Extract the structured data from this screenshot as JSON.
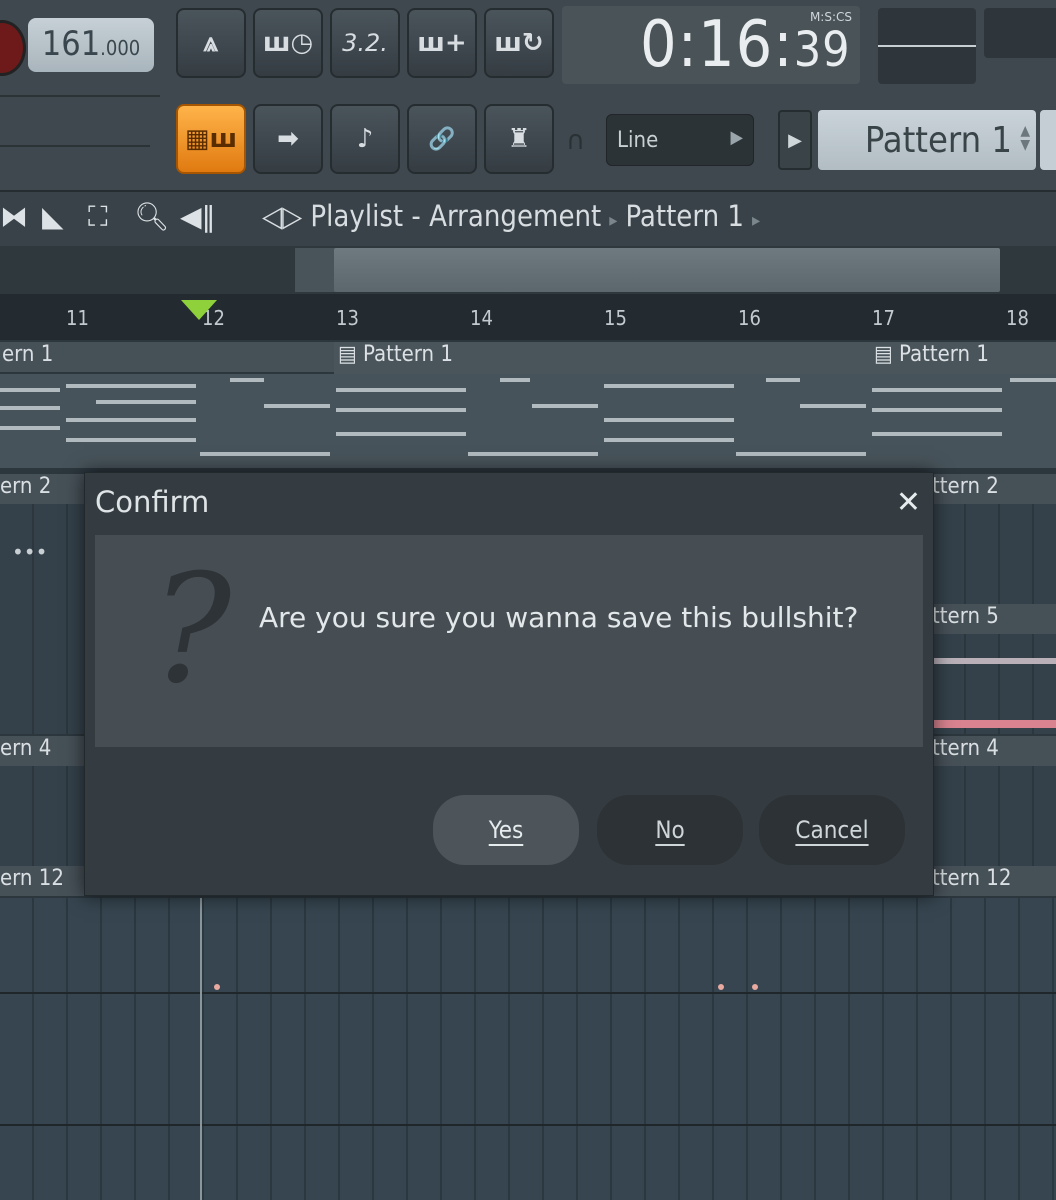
{
  "toolbar": {
    "tempo_main": "161",
    "tempo_decimal": ".000",
    "buttons_row1": [
      {
        "name": "metronome-icon",
        "glyph": "⩓"
      },
      {
        "name": "wait-for-input-icon",
        "glyph": "ꟺ◷"
      },
      {
        "name": "countdown-icon",
        "glyph": "3.2."
      },
      {
        "name": "step-edit-icon",
        "glyph": "ш+"
      },
      {
        "name": "loop-record-icon",
        "glyph": "ш↻"
      }
    ],
    "buttons_row2": [
      {
        "name": "typing-keyboard-icon",
        "glyph": "▦ш"
      },
      {
        "name": "arrow-icon",
        "glyph": "➡"
      },
      {
        "name": "note-icon",
        "glyph": "♪"
      },
      {
        "name": "link-icon",
        "glyph": "🔗"
      },
      {
        "name": "stamp-icon",
        "glyph": "♜"
      }
    ],
    "time_main": "0:16:",
    "time_sec": "39",
    "time_format_label": "M:S:CS",
    "snap_value": "Line",
    "pattern_selected": "Pattern 1"
  },
  "playlist": {
    "title": "Playlist - Arrangement",
    "current_pattern": "Pattern 1",
    "bar_numbers": [
      "11",
      "12",
      "13",
      "14",
      "15",
      "16",
      "17",
      "18"
    ],
    "tracks": [
      {
        "label": "ern 1"
      },
      {
        "label": "ern 2"
      },
      {
        "label": "ern 4"
      },
      {
        "label": "ern 12"
      }
    ],
    "clip_labels": [
      "Pattern 1",
      "Pattern 1"
    ],
    "right_labels": [
      "ttern 2",
      "ttern 5",
      "ttern 4",
      "ttern 12"
    ],
    "dots_label": "•••"
  },
  "dialog": {
    "title": "Confirm",
    "close_glyph": "✕",
    "icon_glyph": "?",
    "message": "Are you sure you wanna save this bullshit?",
    "buttons": {
      "yes": "Yes",
      "no": "No",
      "cancel": "Cancel"
    }
  }
}
